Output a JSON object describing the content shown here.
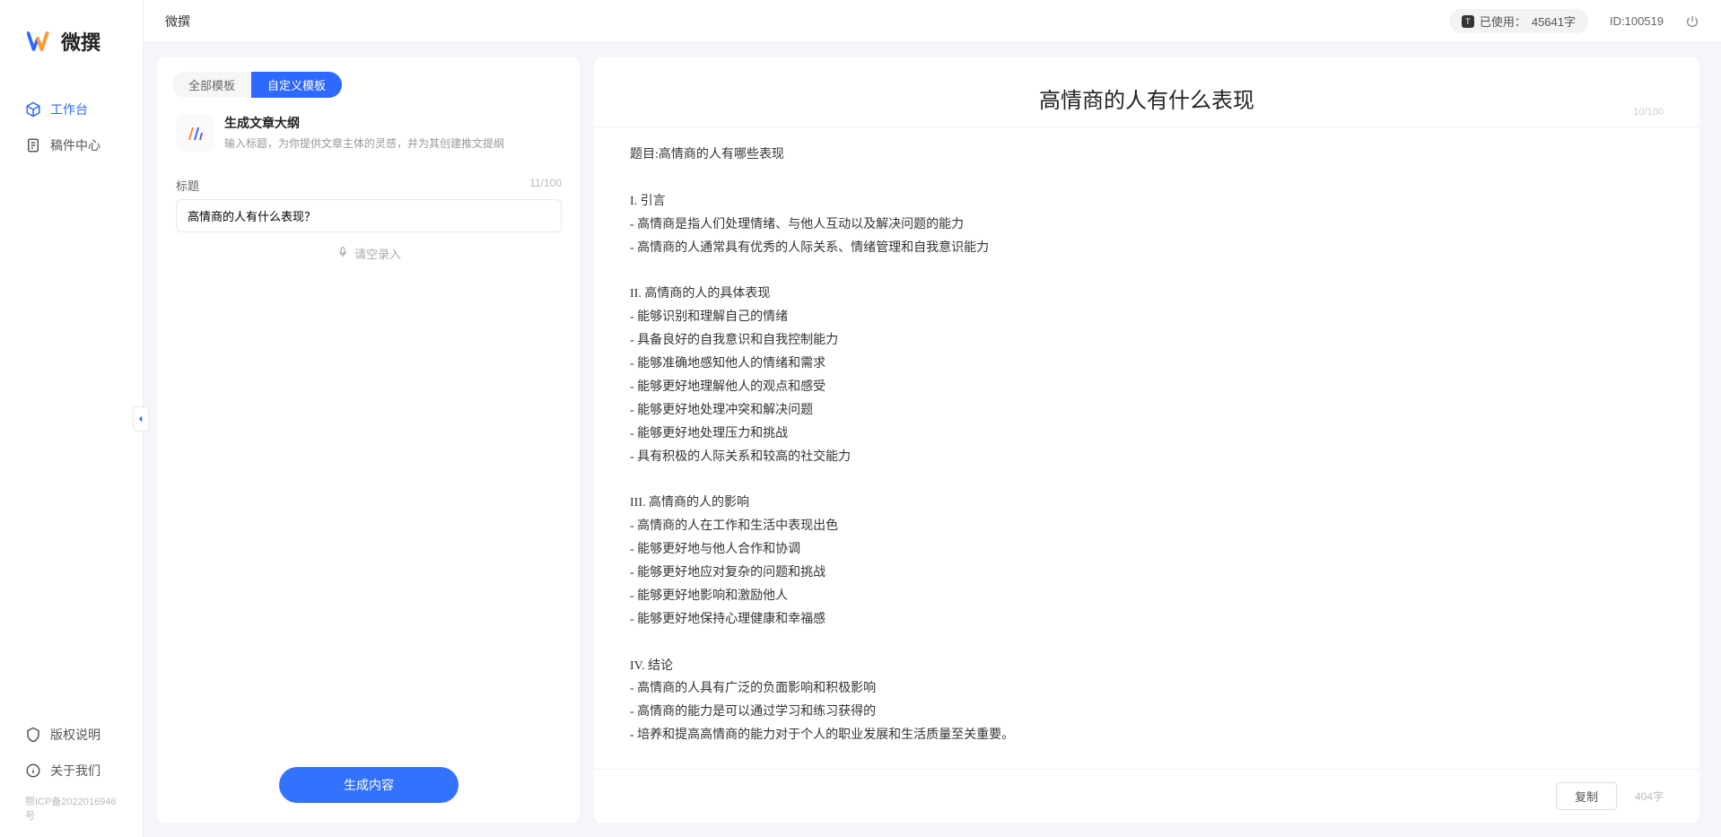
{
  "brand": {
    "name": "微撰"
  },
  "topbar": {
    "title": "微撰",
    "usage_prefix": "已使用：",
    "usage_value": "45641字",
    "id_label": "ID:100519"
  },
  "sidebar": {
    "items": [
      {
        "label": "工作台",
        "active": true,
        "icon": "cube"
      },
      {
        "label": "稿件中心",
        "active": false,
        "icon": "doc"
      }
    ],
    "bottom": [
      {
        "label": "版权说明",
        "icon": "shield"
      },
      {
        "label": "关于我们",
        "icon": "info"
      }
    ],
    "footer_link": "鄂ICP备2022016946号"
  },
  "tabs": [
    {
      "label": "全部模板",
      "active": false
    },
    {
      "label": "自定义模板",
      "active": true
    }
  ],
  "template": {
    "title": "生成文章大纲",
    "desc": "输入标题，为你提供文章主体的灵感，并为其创建推文提纲"
  },
  "form": {
    "label": "标题",
    "counter": "11/100",
    "value": "高情商的人有什么表现？",
    "voice_label": "请空录入"
  },
  "generate_label": "生成内容",
  "output": {
    "title": "高情商的人有什么表现",
    "title_counter": "10/100",
    "body": "题目:高情商的人有哪些表现\n\nI. 引言\n- 高情商是指人们处理情绪、与他人互动以及解决问题的能力\n- 高情商的人通常具有优秀的人际关系、情绪管理和自我意识能力\n\nII. 高情商的人的具体表现\n- 能够识别和理解自己的情绪\n- 具备良好的自我意识和自我控制能力\n- 能够准确地感知他人的情绪和需求\n- 能够更好地理解他人的观点和感受\n- 能够更好地处理冲突和解决问题\n- 能够更好地处理压力和挑战\n- 具有积极的人际关系和较高的社交能力\n\nIII. 高情商的人的影响\n- 高情商的人在工作和生活中表现出色\n- 能够更好地与他人合作和协调\n- 能够更好地应对复杂的问题和挑战\n- 能够更好地影响和激励他人\n- 能够更好地保持心理健康和幸福感\n\nIV. 结论\n- 高情商的人具有广泛的负面影响和积极影响\n- 高情商的能力是可以通过学习和练习获得的\n- 培养和提高高情商的能力对于个人的职业发展和生活质量至关重要。",
    "copy_label": "复制",
    "char_count": "404字"
  }
}
